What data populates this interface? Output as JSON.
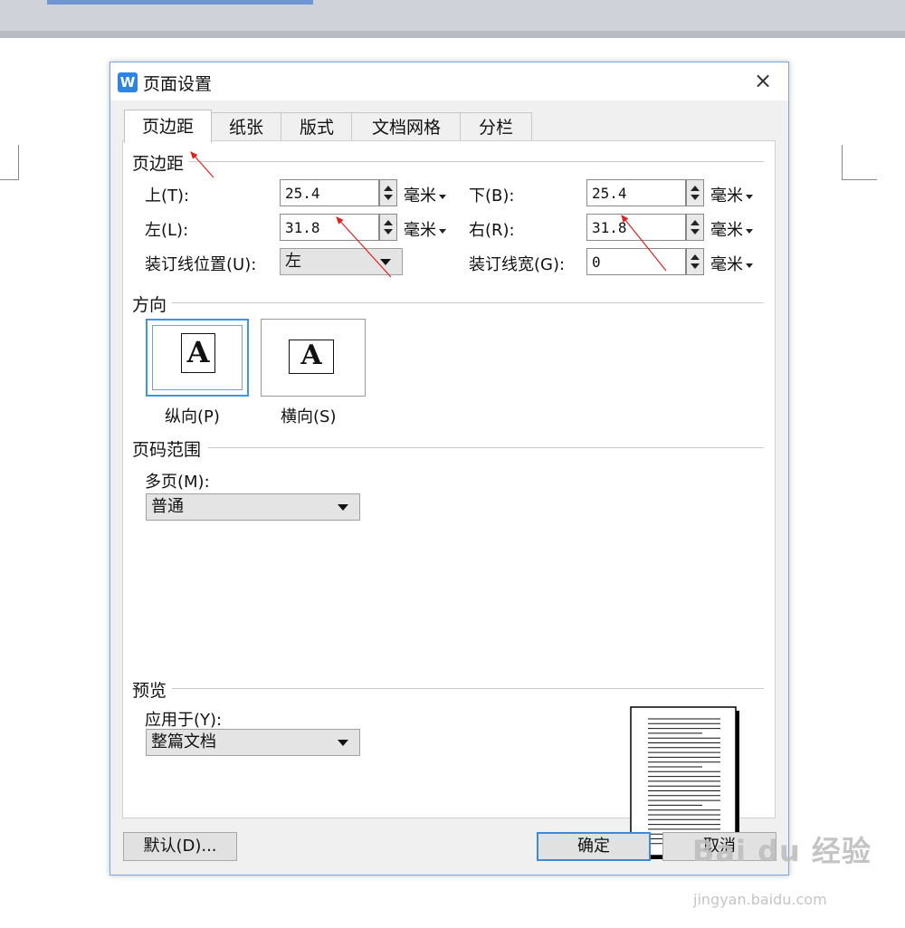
{
  "dialog": {
    "title": "页面设置",
    "app_icon": "wps-writer-icon",
    "close_glyph": "×"
  },
  "tabs": [
    {
      "label": "页边距",
      "active": true
    },
    {
      "label": "纸张",
      "active": false
    },
    {
      "label": "版式",
      "active": false
    },
    {
      "label": "文档网格",
      "active": false
    },
    {
      "label": "分栏",
      "active": false
    }
  ],
  "margins": {
    "section_title": "页边距",
    "top": {
      "label": "上(T):",
      "value": "25.4",
      "unit": "毫米"
    },
    "bottom": {
      "label": "下(B):",
      "value": "25.4",
      "unit": "毫米"
    },
    "left": {
      "label": "左(L):",
      "value": "31.8",
      "unit": "毫米"
    },
    "right": {
      "label": "右(R):",
      "value": "31.8",
      "unit": "毫米"
    },
    "gutter_pos": {
      "label": "装订线位置(U):",
      "value": "左"
    },
    "gutter_width": {
      "label": "装订线宽(G):",
      "value": "0",
      "unit": "毫米"
    }
  },
  "orientation": {
    "section_title": "方向",
    "portrait": {
      "label": "纵向(P)",
      "glyph": "A",
      "selected": true
    },
    "landscape": {
      "label": "横向(S)",
      "glyph": "A",
      "selected": false
    }
  },
  "page_range": {
    "section_title": "页码范围",
    "multi_label": "多页(M):",
    "multi_value": "普通"
  },
  "preview": {
    "section_title": "预览",
    "apply_label": "应用于(Y):",
    "apply_value": "整篇文档"
  },
  "buttons": {
    "default": "默认(D)...",
    "ok": "确定",
    "cancel": "取消"
  },
  "watermark": {
    "brand": "Bai du 经验",
    "url": "jingyan.baidu.com"
  },
  "colors": {
    "accent": "#3c96e6",
    "annotation_arrow": "#e02020"
  }
}
